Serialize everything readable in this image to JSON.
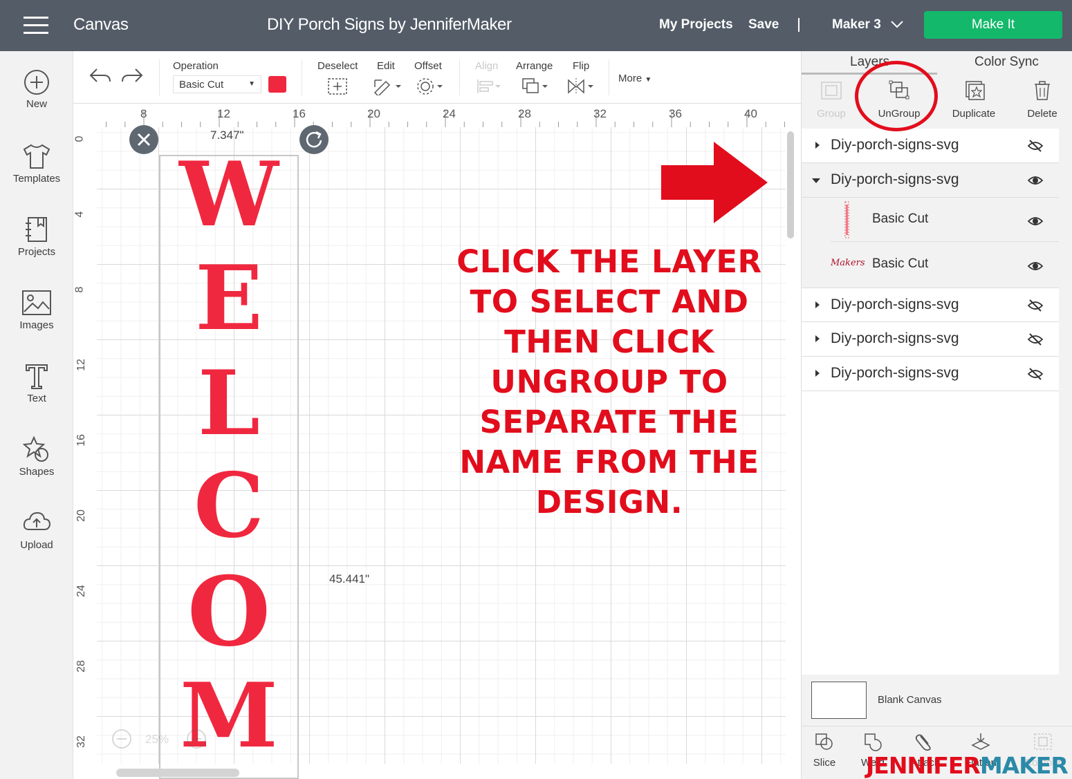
{
  "header": {
    "app_title": "Canvas",
    "project_title": "DIY Porch Signs by JenniferMaker",
    "my_projects": "My Projects",
    "save": "Save",
    "separator": "|",
    "machine": "Maker 3",
    "make_it": "Make It"
  },
  "sidebar": {
    "items": [
      {
        "label": "New",
        "icon": "plus-circle-icon"
      },
      {
        "label": "Templates",
        "icon": "tshirt-icon"
      },
      {
        "label": "Projects",
        "icon": "notebook-icon"
      },
      {
        "label": "Images",
        "icon": "image-icon"
      },
      {
        "label": "Text",
        "icon": "text-t-icon"
      },
      {
        "label": "Shapes",
        "icon": "shapes-icon"
      },
      {
        "label": "Upload",
        "icon": "cloud-upload-icon"
      }
    ]
  },
  "toolbar": {
    "operation_label": "Operation",
    "operation_value": "Basic Cut",
    "operation_color": "#f0283f",
    "deselect": "Deselect",
    "edit": "Edit",
    "offset": "Offset",
    "align": "Align",
    "arrange": "Arrange",
    "flip": "Flip",
    "more": "More"
  },
  "canvas": {
    "ruler_top": [
      "8",
      "12",
      "16",
      "20",
      "24",
      "28",
      "32",
      "36",
      "40"
    ],
    "ruler_left": [
      "0",
      "4",
      "8",
      "12",
      "16",
      "20",
      "24",
      "28",
      "32"
    ],
    "letters": [
      "W",
      "E",
      "L",
      "C",
      "O",
      "M"
    ],
    "width_dim": "7.347\"",
    "height_dim": "45.441\"",
    "zoom": "25%",
    "callout": "CLICK THE LAYER TO SELECT AND THEN CLICK UNGROUP TO SEPARATE THE NAME FROM THE DESIGN.",
    "accent": "#e20d1c"
  },
  "panel": {
    "tabs": [
      "Layers",
      "Color Sync"
    ],
    "actions": [
      {
        "label": "Group",
        "icon": "group-icon",
        "enabled": false
      },
      {
        "label": "UnGroup",
        "icon": "ungroup-icon",
        "enabled": true
      },
      {
        "label": "Duplicate",
        "icon": "duplicate-icon",
        "enabled": true
      },
      {
        "label": "Delete",
        "icon": "trash-icon",
        "enabled": true
      }
    ],
    "layers": [
      {
        "name": "Diy-porch-signs-svg",
        "expanded": false,
        "visible": false
      },
      {
        "name": "Diy-porch-signs-svg",
        "expanded": true,
        "visible": true,
        "children": [
          {
            "name": "Basic Cut",
            "thumb": "",
            "visible": true
          },
          {
            "name": "Basic Cut",
            "thumb": "Makers",
            "visible": true
          }
        ]
      },
      {
        "name": "Diy-porch-signs-svg",
        "expanded": false,
        "visible": false
      },
      {
        "name": "Diy-porch-signs-svg",
        "expanded": false,
        "visible": false
      },
      {
        "name": "Diy-porch-signs-svg",
        "expanded": false,
        "visible": false
      }
    ],
    "blank_canvas": "Blank Canvas",
    "bottom_tools": [
      {
        "label": "Slice",
        "icon": "slice-icon"
      },
      {
        "label": "Weld",
        "icon": "weld-icon"
      },
      {
        "label": "Attach",
        "icon": "attach-icon"
      },
      {
        "label": "Flatten",
        "icon": "flatten-icon"
      },
      {
        "label": "Contour",
        "icon": "contour-icon"
      }
    ]
  },
  "watermark": {
    "part1": "JENNIFER",
    "part2": "MAKER"
  }
}
